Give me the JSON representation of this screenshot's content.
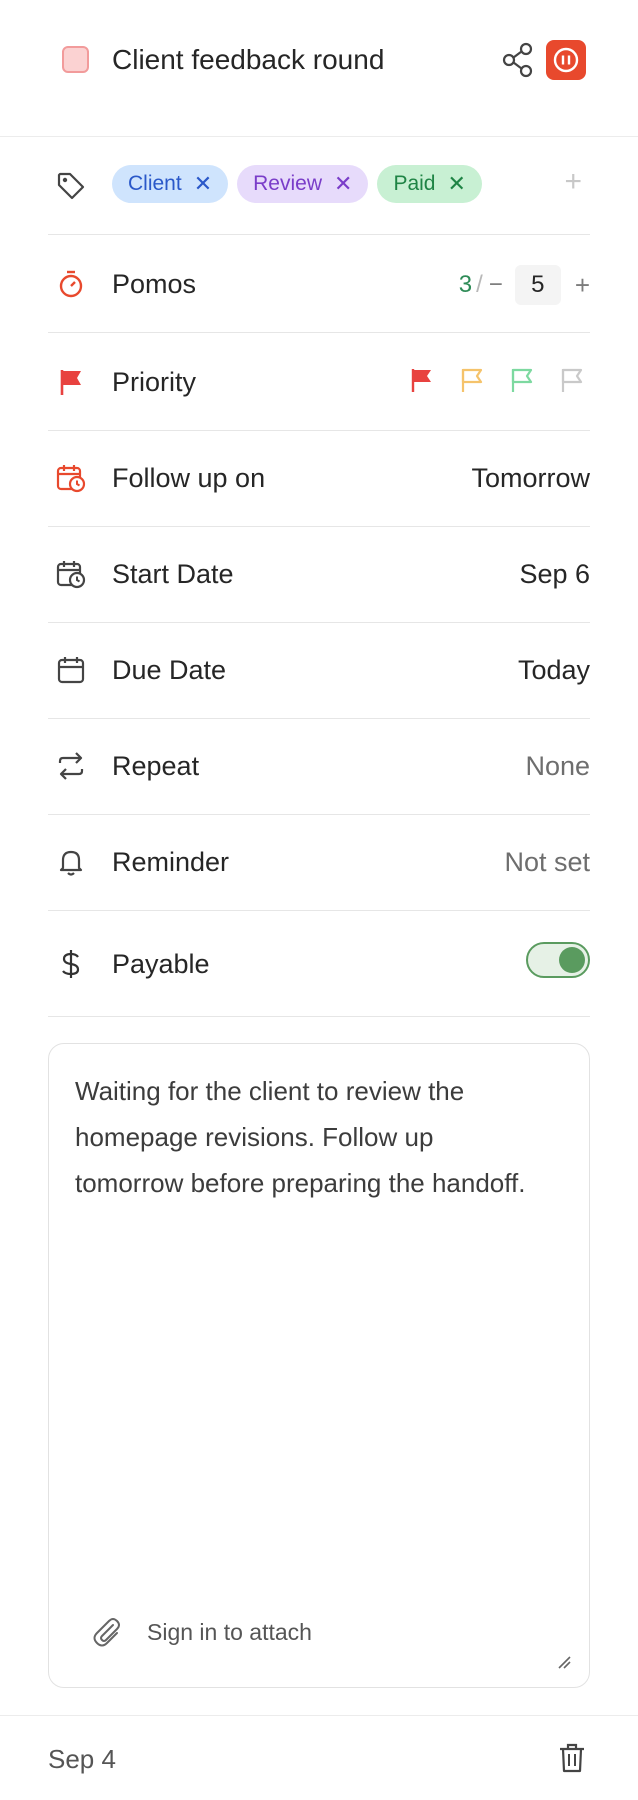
{
  "header": {
    "title": "Client feedback round",
    "check_color": "#fbd2d2",
    "accent": "#e8492d",
    "share_icon": "share-icon",
    "pomo_icon": "pause-timer-icon"
  },
  "tags": {
    "items": [
      {
        "label": "Client",
        "color": "#cfe4fd"
      },
      {
        "label": "Review",
        "color": "#e7dbfb"
      },
      {
        "label": "Paid",
        "color": "#c8f0d3"
      }
    ],
    "remove_glyph": "✕",
    "add_glyph": "+"
  },
  "pomos": {
    "label": "Pomos",
    "done": "3",
    "separator": "/",
    "minus": "−",
    "estimate": "5",
    "plus": "+"
  },
  "priority": {
    "label": "Priority",
    "options": [
      "high",
      "medium",
      "low",
      "none"
    ],
    "colors": [
      "#e8423f",
      "#f5c36b",
      "#7dd9a0",
      "#c9c9c9"
    ]
  },
  "rows": {
    "follow_up": {
      "label": "Follow up on",
      "value": "Tomorrow"
    },
    "start_date": {
      "label": "Start Date",
      "value": "Sep 6"
    },
    "due_date": {
      "label": "Due Date",
      "value": "Today"
    },
    "repeat": {
      "label": "Repeat",
      "value": "None"
    },
    "reminder": {
      "label": "Reminder",
      "value": "Not set"
    },
    "payable": {
      "label": "Payable",
      "enabled": true
    }
  },
  "notes": {
    "text": "Waiting for the client to review the homepage revisions. Follow up tomorrow before preparing the handoff.",
    "attach_label": "Sign in to attach"
  },
  "footer": {
    "date": "Sep 4"
  }
}
